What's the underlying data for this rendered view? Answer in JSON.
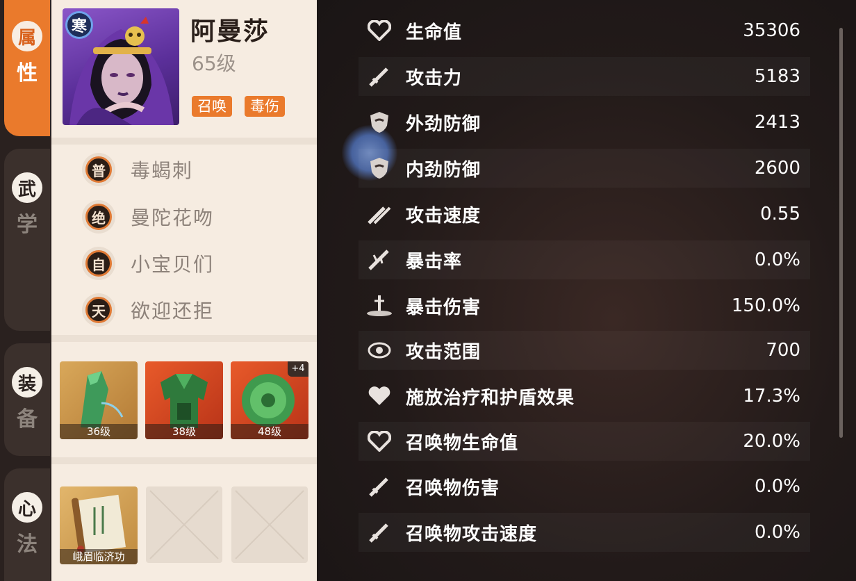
{
  "tabs": [
    {
      "c1": "属",
      "c2": "性",
      "active": true
    },
    {
      "c1": "武",
      "c2": "学",
      "active": false
    },
    {
      "c1": "装",
      "c2": "备",
      "active": false
    },
    {
      "c1": "心",
      "c2": "法",
      "active": false
    }
  ],
  "hero": {
    "name": "阿曼莎",
    "level": "65级",
    "element_badge": "寒",
    "tags": [
      "召唤",
      "毒伤"
    ]
  },
  "skills": [
    {
      "type": "普",
      "name": "毒蝎刺"
    },
    {
      "type": "绝",
      "name": "曼陀花吻"
    },
    {
      "type": "自",
      "name": "小宝贝们"
    },
    {
      "type": "天",
      "name": "欲迎还拒"
    }
  ],
  "equipment": [
    {
      "level": "36级"
    },
    {
      "level": "38级"
    },
    {
      "level": "48级",
      "extra": "+4"
    }
  ],
  "mind_art": {
    "name": "峨眉临济功"
  },
  "stats": [
    {
      "icon": "heart-icon",
      "label": "生命值",
      "value": "35306"
    },
    {
      "icon": "sword-icon",
      "label": "攻击力",
      "value": "5183"
    },
    {
      "icon": "shield-icon",
      "label": "外劲防御",
      "value": "2413"
    },
    {
      "icon": "shield-icon",
      "label": "内劲防御",
      "value": "2600"
    },
    {
      "icon": "crossed-swords-icon",
      "label": "攻击速度",
      "value": "0.55"
    },
    {
      "icon": "crit-icon",
      "label": "暴击率",
      "value": "0.0%"
    },
    {
      "icon": "sword-stuck-icon",
      "label": "暴击伤害",
      "value": "150.0%"
    },
    {
      "icon": "vortex-icon",
      "label": "攻击范围",
      "value": "700"
    },
    {
      "icon": "heart-icon",
      "label": "施放治疗和护盾效果",
      "value": "17.3%"
    },
    {
      "icon": "heart-icon",
      "label": "召唤物生命值",
      "value": "20.0%"
    },
    {
      "icon": "sword-icon",
      "label": "召唤物伤害",
      "value": "0.0%"
    },
    {
      "icon": "sword-icon",
      "label": "召唤物攻击速度",
      "value": "0.0%"
    }
  ],
  "colors": {
    "accent": "#ea7a2c",
    "panel": "#f3e9de",
    "dark": "#1d1716"
  }
}
